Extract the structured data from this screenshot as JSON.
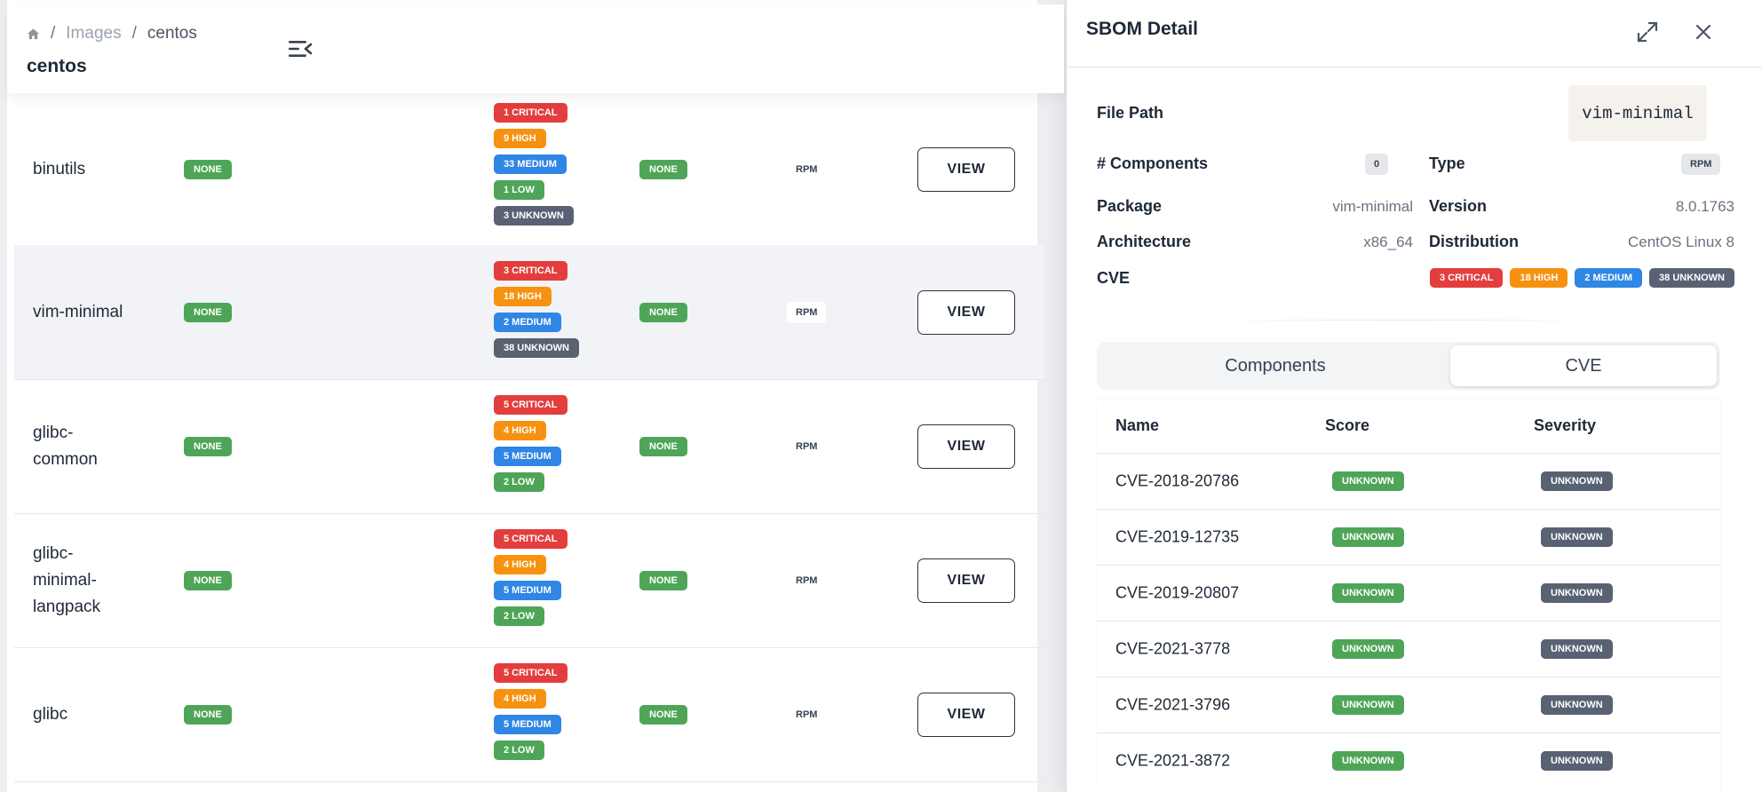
{
  "breadcrumb": {
    "home_icon": "home-icon",
    "items": [
      "Images",
      "centos"
    ]
  },
  "page_title": "centos",
  "rows": [
    {
      "name": "binutils",
      "status_a": "NONE",
      "cves": [
        {
          "label": "1 CRITICAL",
          "color": "#e33d3d"
        },
        {
          "label": "9 HIGH",
          "color": "#f6920f"
        },
        {
          "label": "33 MEDIUM",
          "color": "#2f86e4"
        },
        {
          "label": "1 LOW",
          "color": "#4ea558"
        },
        {
          "label": "3 UNKNOWN",
          "color": "#596273"
        }
      ],
      "status_b": "NONE",
      "type": "RPM",
      "action": "VIEW"
    },
    {
      "name": "vim-minimal",
      "status_a": "NONE",
      "cves": [
        {
          "label": "3 CRITICAL",
          "color": "#e33d3d"
        },
        {
          "label": "18 HIGH",
          "color": "#f6920f"
        },
        {
          "label": "2 MEDIUM",
          "color": "#2f86e4"
        },
        {
          "label": "38 UNKNOWN",
          "color": "#596273"
        }
      ],
      "status_b": "NONE",
      "type": "RPM",
      "action": "VIEW"
    },
    {
      "name": "glibc-\ncommon",
      "status_a": "NONE",
      "cves": [
        {
          "label": "5 CRITICAL",
          "color": "#e33d3d"
        },
        {
          "label": "4 HIGH",
          "color": "#f6920f"
        },
        {
          "label": "5 MEDIUM",
          "color": "#2f86e4"
        },
        {
          "label": "2 LOW",
          "color": "#4ea558"
        }
      ],
      "status_b": "NONE",
      "type": "RPM",
      "action": "VIEW"
    },
    {
      "name": "glibc-\nminimal-\nlangpack",
      "status_a": "NONE",
      "cves": [
        {
          "label": "5 CRITICAL",
          "color": "#e33d3d"
        },
        {
          "label": "4 HIGH",
          "color": "#f6920f"
        },
        {
          "label": "5 MEDIUM",
          "color": "#2f86e4"
        },
        {
          "label": "2 LOW",
          "color": "#4ea558"
        }
      ],
      "status_b": "NONE",
      "type": "RPM",
      "action": "VIEW"
    },
    {
      "name": "glibc",
      "status_a": "NONE",
      "cves": [
        {
          "label": "5 CRITICAL",
          "color": "#e33d3d"
        },
        {
          "label": "4 HIGH",
          "color": "#f6920f"
        },
        {
          "label": "5 MEDIUM",
          "color": "#2f86e4"
        },
        {
          "label": "2 LOW",
          "color": "#4ea558"
        }
      ],
      "status_b": "NONE",
      "type": "RPM",
      "action": "VIEW"
    }
  ],
  "panel": {
    "title": "SBOM Detail",
    "file_path_label": "File Path",
    "file_path": "vim-minimal",
    "components_label": "# Components",
    "components_count": "0",
    "type_label": "Type",
    "type": "RPM",
    "package_label": "Package",
    "package": "vim-minimal",
    "version_label": "Version",
    "version": "8.0.1763",
    "architecture_label": "Architecture",
    "architecture": "x86_64",
    "distribution_label": "Distribution",
    "distribution": "CentOS Linux 8",
    "cve_label": "CVE",
    "cve_summary": [
      {
        "label": "3 CRITICAL",
        "color": "#e33d3d"
      },
      {
        "label": "18 HIGH",
        "color": "#f6920f"
      },
      {
        "label": "2 MEDIUM",
        "color": "#2f86e4"
      },
      {
        "label": "38 UNKNOWN",
        "color": "#596273"
      }
    ],
    "tabs": [
      "Components",
      "CVE"
    ],
    "active_tab": "CVE",
    "table": {
      "headers": [
        "Name",
        "Score",
        "Severity"
      ],
      "rows": [
        {
          "name": "CVE-2018-20786",
          "score": "UNKNOWN",
          "severity": "UNKNOWN"
        },
        {
          "name": "CVE-2019-12735",
          "score": "UNKNOWN",
          "severity": "UNKNOWN"
        },
        {
          "name": "CVE-2019-20807",
          "score": "UNKNOWN",
          "severity": "UNKNOWN"
        },
        {
          "name": "CVE-2021-3778",
          "score": "UNKNOWN",
          "severity": "UNKNOWN"
        },
        {
          "name": "CVE-2021-3796",
          "score": "UNKNOWN",
          "severity": "UNKNOWN"
        },
        {
          "name": "CVE-2021-3872",
          "score": "UNKNOWN",
          "severity": "UNKNOWN"
        }
      ]
    }
  },
  "colors": {
    "green": "#4ea558",
    "red": "#e33d3d",
    "orange": "#f6920f",
    "blue": "#2f86e4",
    "gray": "#596273"
  }
}
